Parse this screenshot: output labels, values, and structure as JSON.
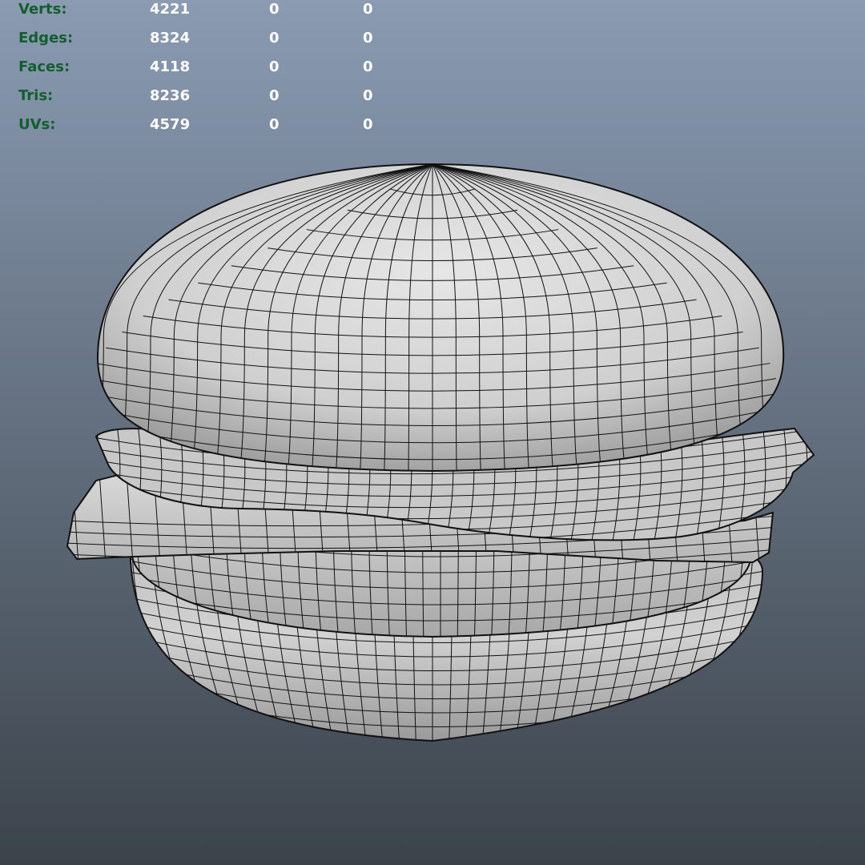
{
  "viewport": {
    "background_top": "#8a9bb2",
    "background_bottom": "#3c434b",
    "label_color": "#125e2e",
    "value_color": "#ffffff",
    "mesh_face_color": "#c7c7c7",
    "wireframe_color": "#111111"
  },
  "hud": {
    "rows": [
      {
        "label": "Verts:",
        "values": [
          "4221",
          "0",
          "0"
        ]
      },
      {
        "label": "Edges:",
        "values": [
          "8324",
          "0",
          "0"
        ]
      },
      {
        "label": "Faces:",
        "values": [
          "4118",
          "0",
          "0"
        ]
      },
      {
        "label": "Tris:",
        "values": [
          "8236",
          "0",
          "0"
        ]
      },
      {
        "label": "UVs:",
        "values": [
          "4579",
          "0",
          "0"
        ]
      }
    ]
  },
  "model": {
    "object": "hamburger-mesh",
    "parts": [
      "top-bun",
      "cheese-slice",
      "lettuce-leaf",
      "patty",
      "bottom-bun"
    ]
  }
}
